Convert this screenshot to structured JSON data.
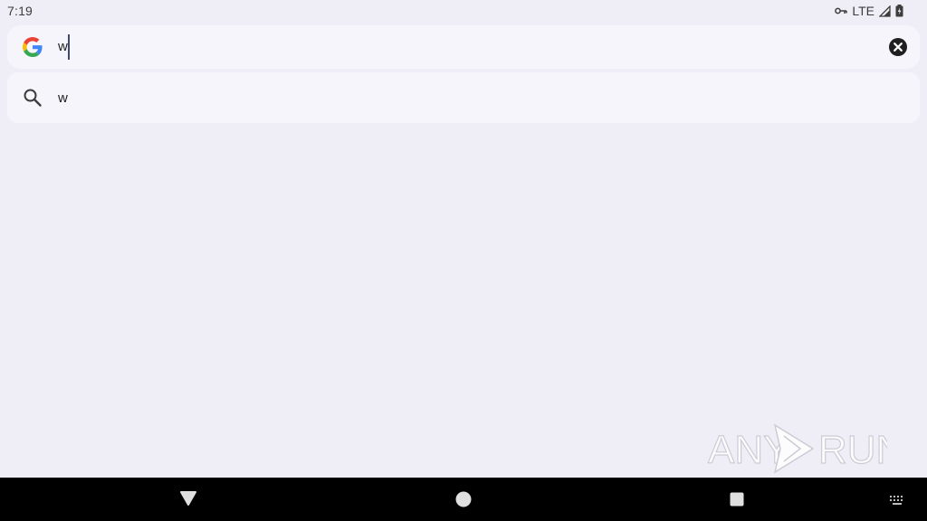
{
  "status_bar": {
    "time": "7:19",
    "network": "LTE",
    "icons": [
      "vpn-key-icon",
      "signal-icon",
      "battery-icon"
    ]
  },
  "search": {
    "query": "w",
    "logo": "google-g-logo",
    "clear_icon": "clear-icon"
  },
  "suggestions": [
    {
      "icon": "search-icon",
      "text": "w"
    }
  ],
  "watermark": {
    "text_left": "ANY",
    "text_right": "RUN"
  },
  "nav_bar": {
    "buttons": [
      "back-icon",
      "home-icon",
      "recents-icon",
      "keyboard-icon"
    ]
  },
  "colors": {
    "background": "#efedf5",
    "card": "#f7f5fc",
    "nav_bar": "#000000",
    "google_blue": "#4285F4",
    "google_red": "#EA4335",
    "google_yellow": "#FBBC05",
    "google_green": "#34A853"
  }
}
